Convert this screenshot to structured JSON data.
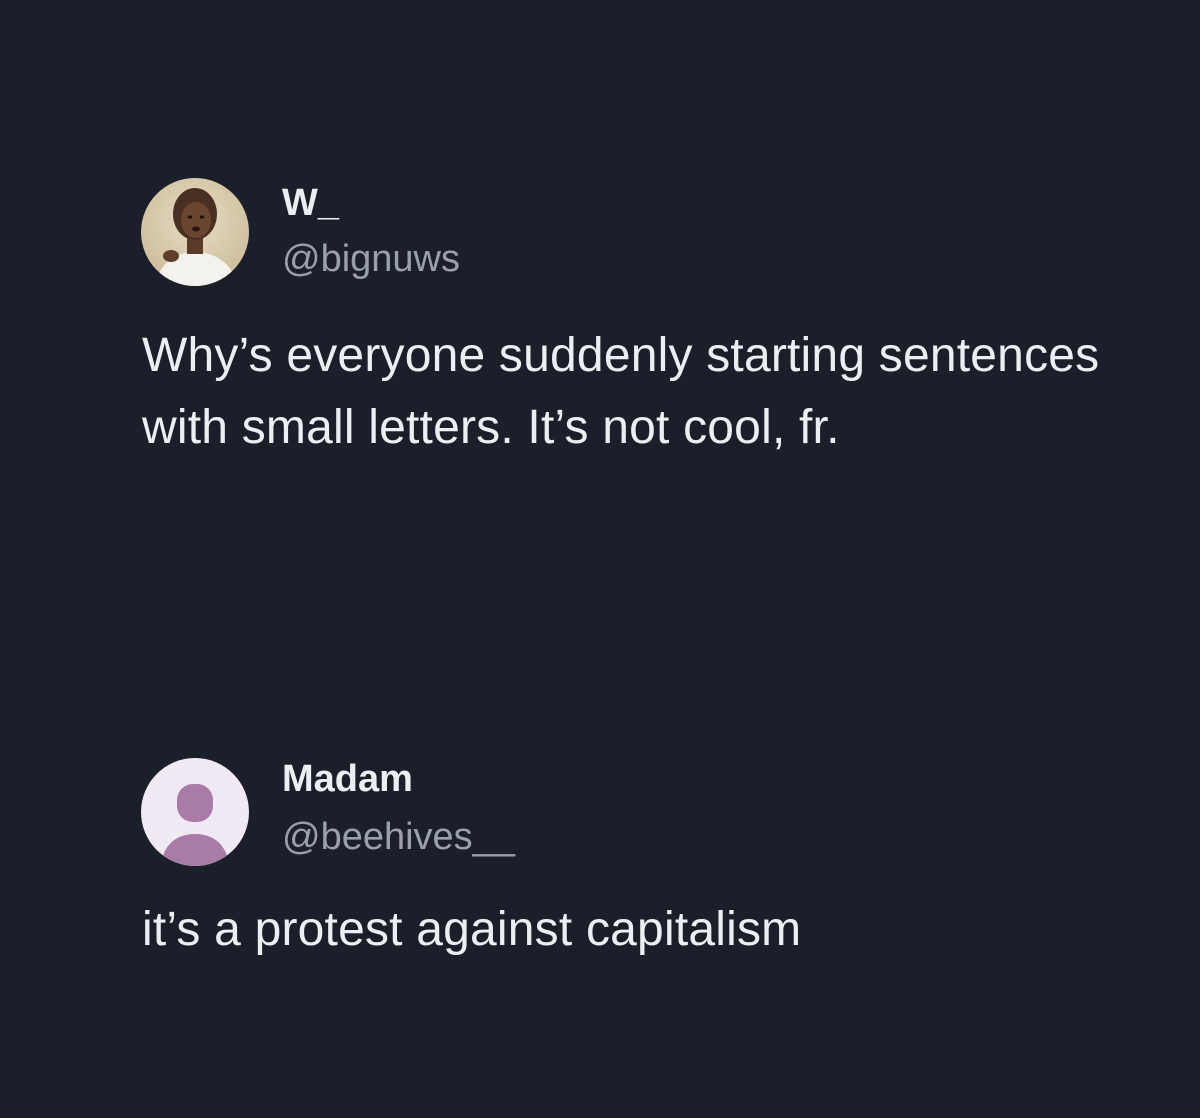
{
  "tweets": [
    {
      "display_name": "W_",
      "handle": "@bignuws",
      "text": "Why’s everyone suddenly starting sentences with small letters. It’s not cool, fr.",
      "avatar": "profile-photo-avatar"
    },
    {
      "display_name": "Madam",
      "handle": "@beehives__",
      "text": "it’s a protest against capitalism",
      "avatar": "default-person-avatar-icon"
    }
  ],
  "colors": {
    "background": "#1b1f29",
    "text": "#eceef1",
    "handle": "#9aa0aa",
    "default_avatar_bg": "#f1e9f3",
    "default_avatar_figure": "#a97ca7"
  }
}
